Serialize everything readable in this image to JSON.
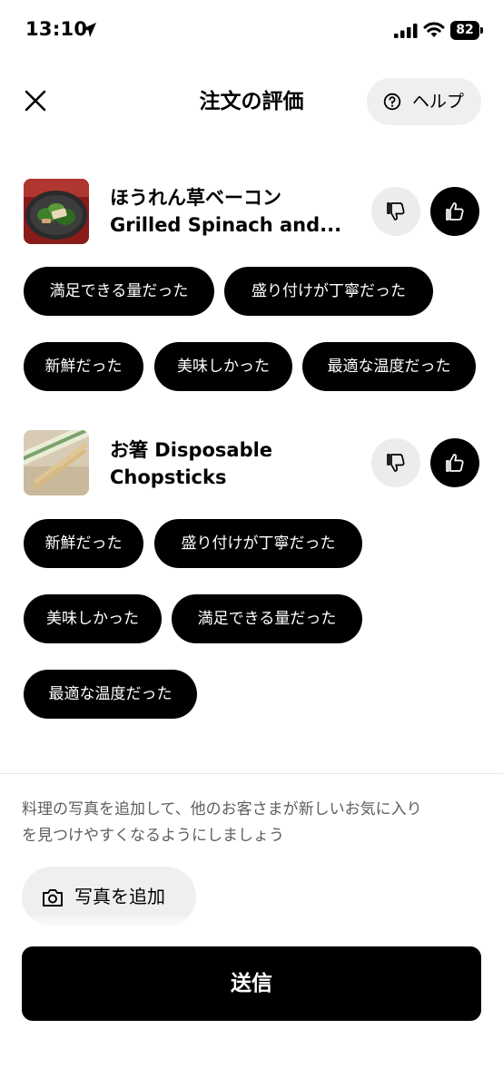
{
  "status_bar": {
    "time": "13:10",
    "battery": "82"
  },
  "header": {
    "title": "注文の評価",
    "help_label": "ヘルプ"
  },
  "items": [
    {
      "name_line1": "ほうれん草ベーコン",
      "name_line2": "Grilled Spinach and...",
      "thumbnail": "spinach-bacon-dish",
      "tags": [
        "満足できる量だった",
        "盛り付けが丁寧だった",
        "新鮮だった",
        "美味しかった",
        "最適な温度だった"
      ]
    },
    {
      "name_line1": "お箸 Disposable",
      "name_line2": "Chopsticks",
      "thumbnail": "chopsticks",
      "tags": [
        "新鮮だった",
        "盛り付けが丁寧だった",
        "美味しかった",
        "満足できる量だった",
        "最適な温度だった"
      ]
    }
  ],
  "photo_section": {
    "hint_line1": "料理の写真を追加して、他のお客さまが新しいお気に入り",
    "hint_line2": "を見つけやすくなるようにしましょう",
    "add_photo_label": "写真を追加"
  },
  "submit_label": "送信",
  "icons": [
    "location-arrow-icon",
    "signal-icon",
    "wifi-icon",
    "close-icon",
    "help-circle-icon",
    "thumbs-down-icon",
    "thumbs-up-icon",
    "camera-icon"
  ],
  "colors": {
    "chip_bg": "#000000",
    "chip_text": "#ffffff",
    "secondary_bg": "#efefef",
    "hint_text": "#5e5e5e"
  }
}
